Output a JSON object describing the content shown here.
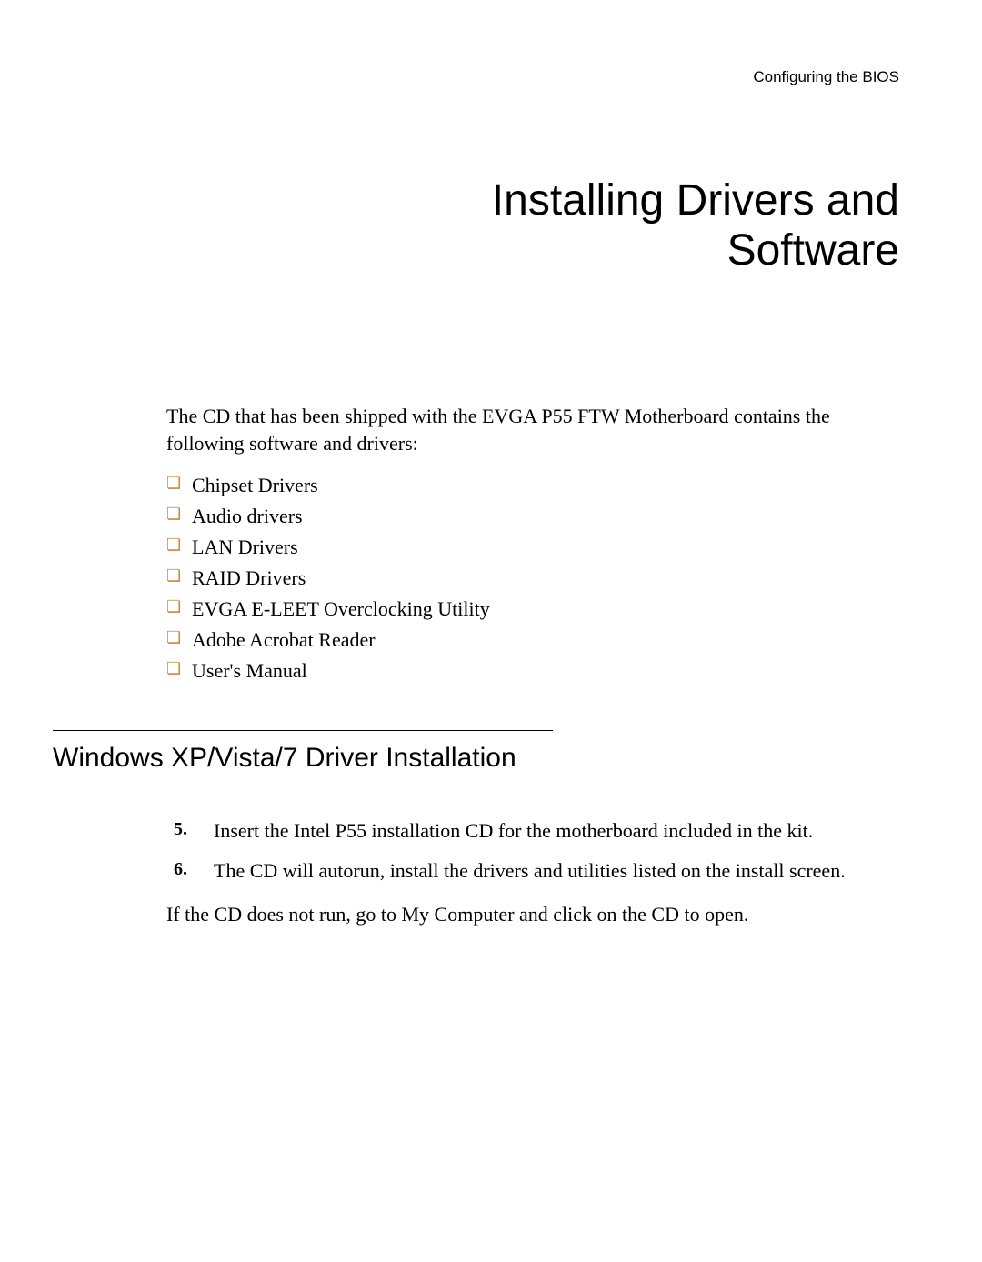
{
  "header": {
    "label": "Configuring the BIOS"
  },
  "title": {
    "line1": "Installing Drivers and",
    "line2": "Software"
  },
  "intro": "The CD that has been shipped with the EVGA P55 FTW Motherboard contains the following software and drivers:",
  "bullets": [
    "Chipset Drivers",
    "Audio drivers",
    "LAN Drivers",
    "RAID Drivers",
    "EVGA E-LEET Overclocking Utility",
    "Adobe Acrobat Reader",
    "User's Manual"
  ],
  "section": {
    "heading": "Windows XP/Vista/7 Driver Installation",
    "steps": [
      "Insert the Intel P55 installation CD for the motherboard included in the kit.",
      "The CD will autorun, install the drivers and utilities listed on the install screen."
    ],
    "closing": "If the CD does not run, go to My Computer and click on the CD to open."
  }
}
